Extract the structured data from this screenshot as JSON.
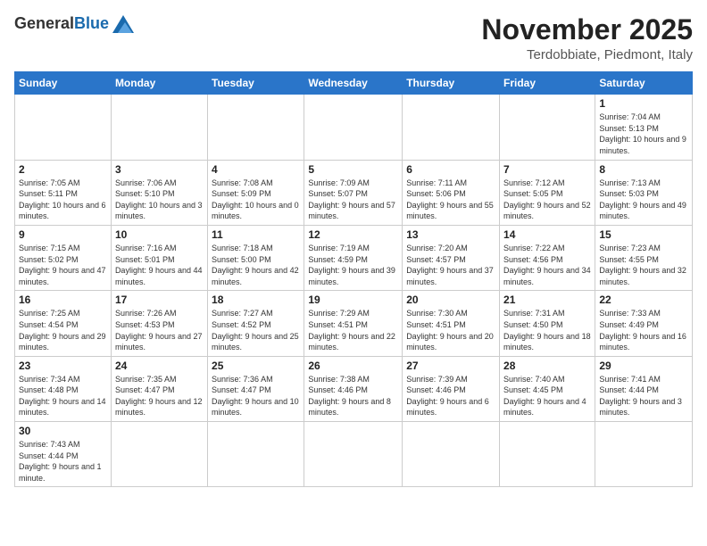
{
  "header": {
    "logo": {
      "general": "General",
      "blue": "Blue"
    },
    "title": "November 2025",
    "location": "Terdobbiate, Piedmont, Italy"
  },
  "days_of_week": [
    "Sunday",
    "Monday",
    "Tuesday",
    "Wednesday",
    "Thursday",
    "Friday",
    "Saturday"
  ],
  "weeks": [
    [
      {
        "day": "",
        "info": ""
      },
      {
        "day": "",
        "info": ""
      },
      {
        "day": "",
        "info": ""
      },
      {
        "day": "",
        "info": ""
      },
      {
        "day": "",
        "info": ""
      },
      {
        "day": "",
        "info": ""
      },
      {
        "day": "1",
        "info": "Sunrise: 7:04 AM\nSunset: 5:13 PM\nDaylight: 10 hours and 9 minutes."
      }
    ],
    [
      {
        "day": "2",
        "info": "Sunrise: 7:05 AM\nSunset: 5:11 PM\nDaylight: 10 hours and 6 minutes."
      },
      {
        "day": "3",
        "info": "Sunrise: 7:06 AM\nSunset: 5:10 PM\nDaylight: 10 hours and 3 minutes."
      },
      {
        "day": "4",
        "info": "Sunrise: 7:08 AM\nSunset: 5:09 PM\nDaylight: 10 hours and 0 minutes."
      },
      {
        "day": "5",
        "info": "Sunrise: 7:09 AM\nSunset: 5:07 PM\nDaylight: 9 hours and 57 minutes."
      },
      {
        "day": "6",
        "info": "Sunrise: 7:11 AM\nSunset: 5:06 PM\nDaylight: 9 hours and 55 minutes."
      },
      {
        "day": "7",
        "info": "Sunrise: 7:12 AM\nSunset: 5:05 PM\nDaylight: 9 hours and 52 minutes."
      },
      {
        "day": "8",
        "info": "Sunrise: 7:13 AM\nSunset: 5:03 PM\nDaylight: 9 hours and 49 minutes."
      }
    ],
    [
      {
        "day": "9",
        "info": "Sunrise: 7:15 AM\nSunset: 5:02 PM\nDaylight: 9 hours and 47 minutes."
      },
      {
        "day": "10",
        "info": "Sunrise: 7:16 AM\nSunset: 5:01 PM\nDaylight: 9 hours and 44 minutes."
      },
      {
        "day": "11",
        "info": "Sunrise: 7:18 AM\nSunset: 5:00 PM\nDaylight: 9 hours and 42 minutes."
      },
      {
        "day": "12",
        "info": "Sunrise: 7:19 AM\nSunset: 4:59 PM\nDaylight: 9 hours and 39 minutes."
      },
      {
        "day": "13",
        "info": "Sunrise: 7:20 AM\nSunset: 4:57 PM\nDaylight: 9 hours and 37 minutes."
      },
      {
        "day": "14",
        "info": "Sunrise: 7:22 AM\nSunset: 4:56 PM\nDaylight: 9 hours and 34 minutes."
      },
      {
        "day": "15",
        "info": "Sunrise: 7:23 AM\nSunset: 4:55 PM\nDaylight: 9 hours and 32 minutes."
      }
    ],
    [
      {
        "day": "16",
        "info": "Sunrise: 7:25 AM\nSunset: 4:54 PM\nDaylight: 9 hours and 29 minutes."
      },
      {
        "day": "17",
        "info": "Sunrise: 7:26 AM\nSunset: 4:53 PM\nDaylight: 9 hours and 27 minutes."
      },
      {
        "day": "18",
        "info": "Sunrise: 7:27 AM\nSunset: 4:52 PM\nDaylight: 9 hours and 25 minutes."
      },
      {
        "day": "19",
        "info": "Sunrise: 7:29 AM\nSunset: 4:51 PM\nDaylight: 9 hours and 22 minutes."
      },
      {
        "day": "20",
        "info": "Sunrise: 7:30 AM\nSunset: 4:51 PM\nDaylight: 9 hours and 20 minutes."
      },
      {
        "day": "21",
        "info": "Sunrise: 7:31 AM\nSunset: 4:50 PM\nDaylight: 9 hours and 18 minutes."
      },
      {
        "day": "22",
        "info": "Sunrise: 7:33 AM\nSunset: 4:49 PM\nDaylight: 9 hours and 16 minutes."
      }
    ],
    [
      {
        "day": "23",
        "info": "Sunrise: 7:34 AM\nSunset: 4:48 PM\nDaylight: 9 hours and 14 minutes."
      },
      {
        "day": "24",
        "info": "Sunrise: 7:35 AM\nSunset: 4:47 PM\nDaylight: 9 hours and 12 minutes."
      },
      {
        "day": "25",
        "info": "Sunrise: 7:36 AM\nSunset: 4:47 PM\nDaylight: 9 hours and 10 minutes."
      },
      {
        "day": "26",
        "info": "Sunrise: 7:38 AM\nSunset: 4:46 PM\nDaylight: 9 hours and 8 minutes."
      },
      {
        "day": "27",
        "info": "Sunrise: 7:39 AM\nSunset: 4:46 PM\nDaylight: 9 hours and 6 minutes."
      },
      {
        "day": "28",
        "info": "Sunrise: 7:40 AM\nSunset: 4:45 PM\nDaylight: 9 hours and 4 minutes."
      },
      {
        "day": "29",
        "info": "Sunrise: 7:41 AM\nSunset: 4:44 PM\nDaylight: 9 hours and 3 minutes."
      }
    ],
    [
      {
        "day": "30",
        "info": "Sunrise: 7:43 AM\nSunset: 4:44 PM\nDaylight: 9 hours and 1 minute."
      },
      {
        "day": "",
        "info": ""
      },
      {
        "day": "",
        "info": ""
      },
      {
        "day": "",
        "info": ""
      },
      {
        "day": "",
        "info": ""
      },
      {
        "day": "",
        "info": ""
      },
      {
        "day": "",
        "info": ""
      }
    ]
  ]
}
